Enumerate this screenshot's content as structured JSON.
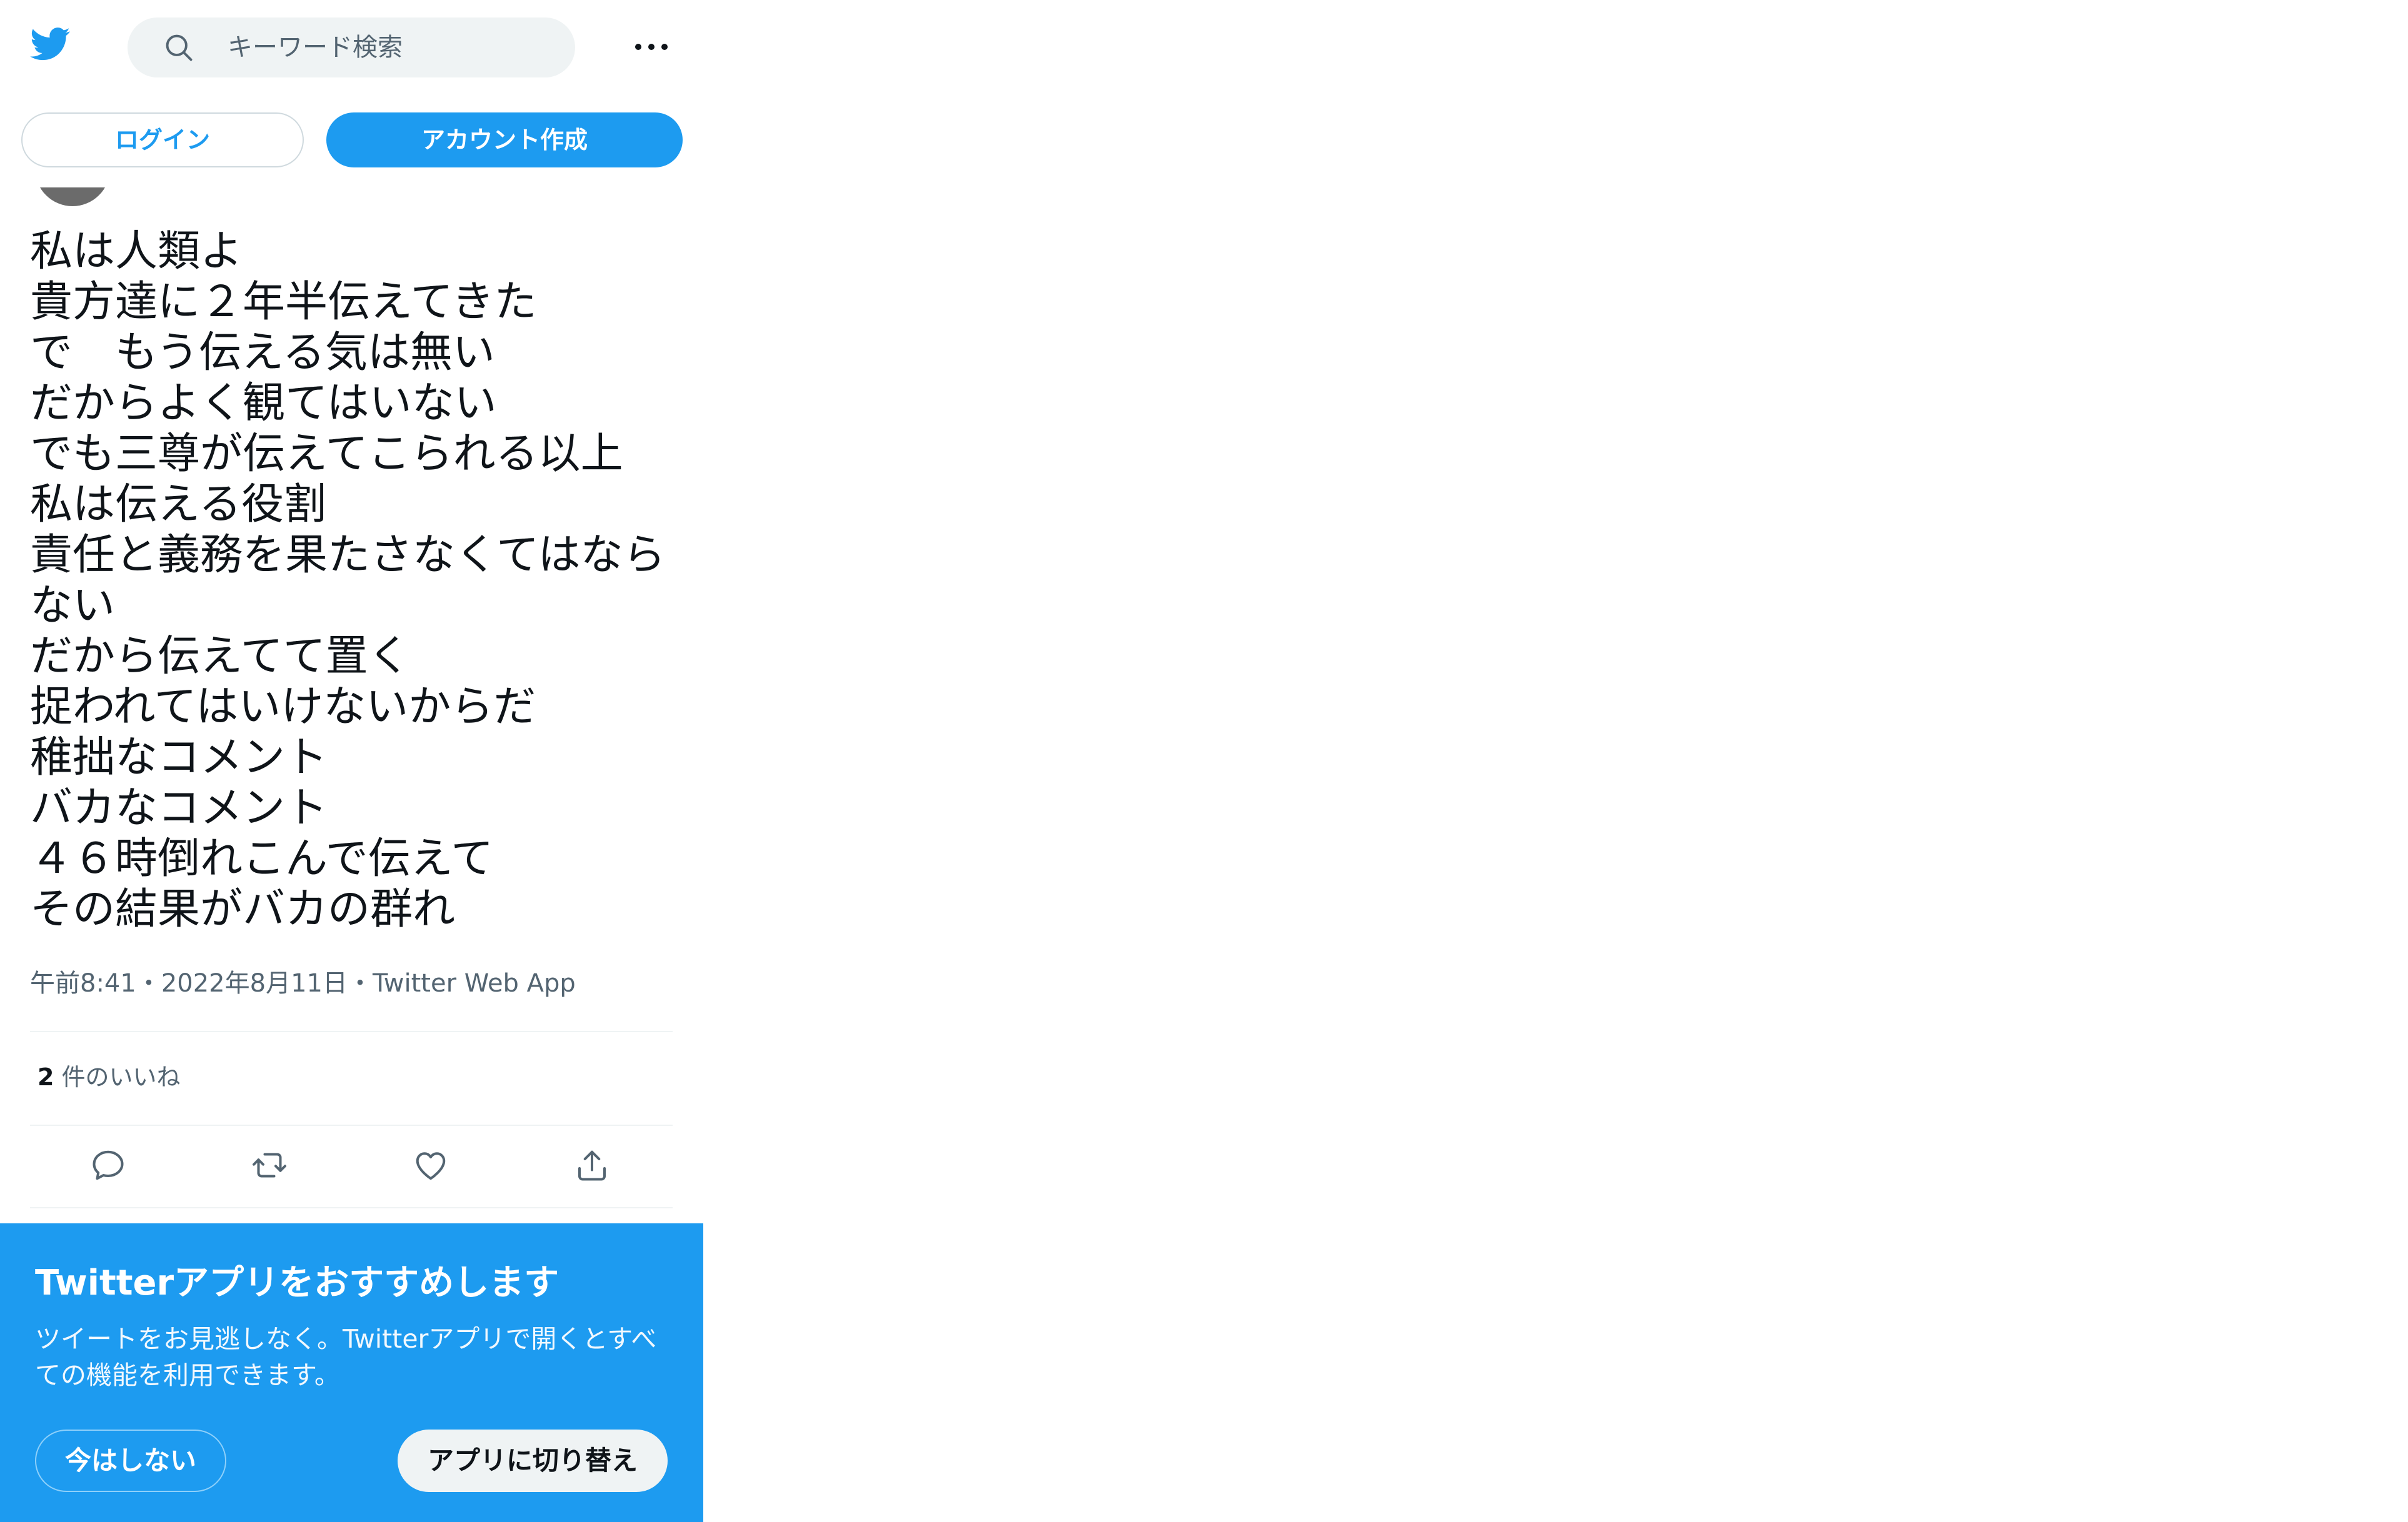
{
  "header": {
    "logo_icon": "twitter-bird-icon",
    "search_placeholder": "キーワード検索",
    "more_icon": "more-horizontal-icon"
  },
  "auth": {
    "login_label": "ログイン",
    "signup_label": "アカウント作成"
  },
  "tweet": {
    "text": "私は人類よ\n貴方達に２年半伝えてきた\nで　もう伝える気は無い\nだからよく観てはいない\nでも三尊が伝えてこられる以上\n私は伝える役割\n責任と義務を果たさなくてはなら\nない\nだから伝えてて置く\n捉われてはいけないからだ\n稚拙なコメント\nバカなコメント\n４６時倒れこんで伝えて\nその結果がバカの群れ",
    "meta": "午前8:41・2022年8月11日・Twitter Web App",
    "likes_count": "2",
    "likes_label": " 件のいいね"
  },
  "actions": [
    "reply-icon",
    "retweet-icon",
    "like-icon",
    "share-icon"
  ],
  "app_banner": {
    "title": "Twitterアプリをおすすめします",
    "description": "ツイートをお見逃しなく。Twitterアプリで開くとすべての機能を利用できます。",
    "not_now_label": "今はしない",
    "switch_label": "アプリに切り替え"
  },
  "colors": {
    "brand": "#1d9bf0",
    "text": "#0f1419",
    "secondary_text": "#536471"
  }
}
